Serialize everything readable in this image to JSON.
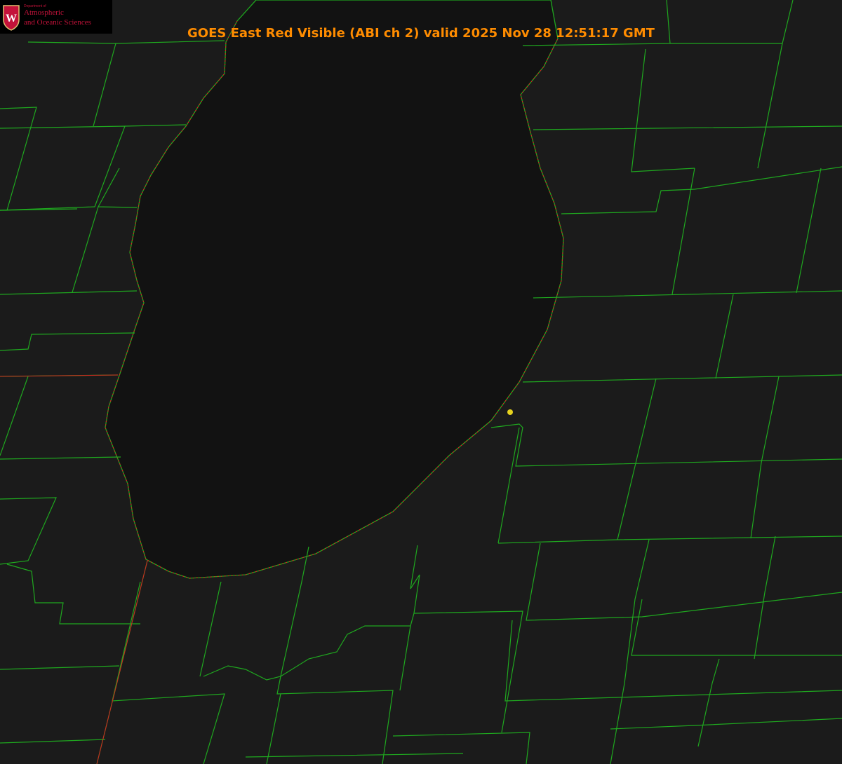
{
  "title": "GOES East Red Visible (ABI ch 2) valid 2025 Nov 28 12:51:17 GMT",
  "logo": {
    "department": "Department of",
    "line1": "Atmospheric",
    "line2": "and Oceanic Sciences",
    "shield_letter": "W"
  },
  "colors": {
    "county_lines": "#1fa81f",
    "shoreline": "#d42020",
    "marker": "#e6d21e",
    "title": "#ff8c00",
    "lake": "#121212",
    "land": "#1c1c1c"
  }
}
